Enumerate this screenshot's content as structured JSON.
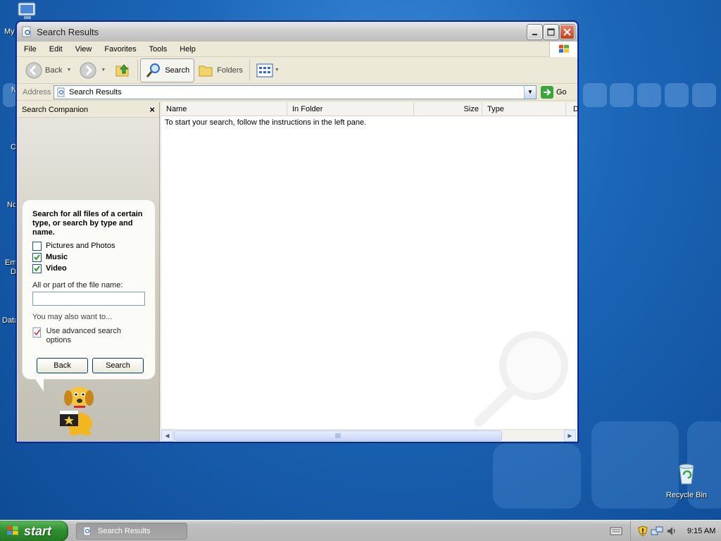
{
  "desktop": {
    "left_labels": [
      "My",
      "N",
      "C",
      "No",
      "Em",
      "D",
      "Data"
    ],
    "recycle_bin_label": "Recycle Bin"
  },
  "window": {
    "title": "Search Results",
    "menu": [
      "File",
      "Edit",
      "View",
      "Favorites",
      "Tools",
      "Help"
    ],
    "toolbar": {
      "back_label": "Back",
      "search_label": "Search",
      "folders_label": "Folders"
    },
    "address": {
      "label": "Address",
      "value": "Search Results",
      "go_label": "Go"
    }
  },
  "search_companion": {
    "title": "Search Companion",
    "close_glyph": "×",
    "heading": "Search for all files of a certain type, or search by type and name.",
    "options": [
      {
        "label": "Pictures and Photos",
        "checked": false
      },
      {
        "label": "Music",
        "checked": true
      },
      {
        "label": "Video",
        "checked": true
      }
    ],
    "filename_label": "All or part of the file name:",
    "filename_value": "",
    "may_also": "You may also want to...",
    "advanced_label": "Use advanced search options",
    "back_button": "Back",
    "search_button": "Search"
  },
  "results": {
    "columns": [
      "Name",
      "In Folder",
      "Size",
      "Type",
      "D"
    ],
    "message": "To start your search, follow the instructions in the left pane."
  },
  "taskbar": {
    "start_label": "start",
    "task_label": "Search Results",
    "clock": "9:15 AM"
  },
  "colors": {
    "desktop": "#1c66b8",
    "start_green": "#2f8f2f",
    "window_bg": "#ece9d8",
    "selection_border": "#0831d9"
  }
}
